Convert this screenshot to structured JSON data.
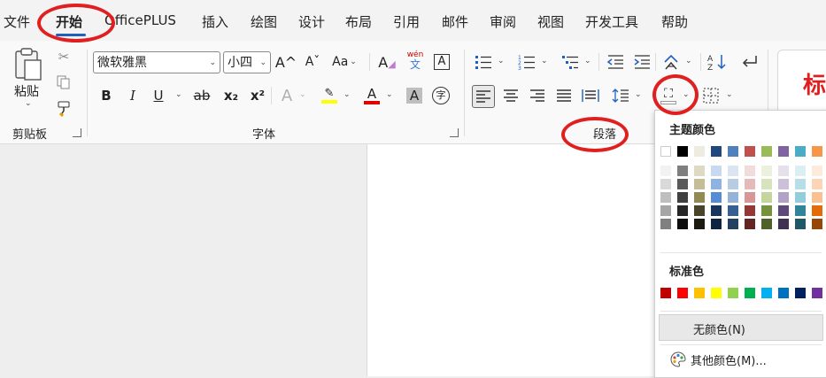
{
  "tabs": [
    "文件",
    "开始",
    "OfficePLUS",
    "插入",
    "绘图",
    "设计",
    "布局",
    "引用",
    "邮件",
    "审阅",
    "视图",
    "开发工具",
    "帮助"
  ],
  "clipboard": {
    "paste_label": "粘贴",
    "group_label": "剪贴板"
  },
  "font": {
    "name": "微软雅黑",
    "size": "小四",
    "group_label": "字体",
    "change_case_label": "Aa",
    "phonetic_top": "wén",
    "phonetic_bottom": "文",
    "char_shading": "A",
    "char_border": "A",
    "char_circle": "字",
    "bold": "B",
    "italic": "I",
    "underline": "U",
    "strike": "ab",
    "sub": "x₂",
    "sup": "x²",
    "grow": "A^",
    "shrink": "Aˇ"
  },
  "paragraph": {
    "group_label": "段落"
  },
  "styles": {
    "sample": "标"
  },
  "shading_menu": {
    "theme_label": "主题颜色",
    "standard_label": "标准色",
    "no_color": "无颜色(N)",
    "more_colors": "其他颜色(M)...",
    "theme_colors": [
      [
        "#ffffff",
        "#f2f2f2",
        "#d9d9d9",
        "#bfbfbf",
        "#a6a6a6",
        "#808080"
      ],
      [
        "#000000",
        "#7f7f7f",
        "#595959",
        "#404040",
        "#262626",
        "#0d0d0d"
      ],
      [
        "#eeece1",
        "#ddd9c3",
        "#c4bd97",
        "#938953",
        "#494429",
        "#1d1b10"
      ],
      [
        "#1f497d",
        "#c6d9f0",
        "#8db3e2",
        "#548dd4",
        "#17365d",
        "#0f243e"
      ],
      [
        "#4f81bd",
        "#dbe5f1",
        "#b8cce4",
        "#95b3d7",
        "#366092",
        "#244061"
      ],
      [
        "#c0504d",
        "#f2dcdb",
        "#e5b9b7",
        "#d99694",
        "#953734",
        "#632423"
      ],
      [
        "#9bbb59",
        "#ebf1dd",
        "#d7e3bc",
        "#c3d69b",
        "#76923c",
        "#4f6128"
      ],
      [
        "#8064a2",
        "#e5e0ec",
        "#ccc1d9",
        "#b2a2c7",
        "#5f497a",
        "#3f3151"
      ],
      [
        "#4bacc6",
        "#dbeef3",
        "#b7dde8",
        "#92cddc",
        "#31859b",
        "#205867"
      ],
      [
        "#f79646",
        "#fdeada",
        "#fbd5b5",
        "#fac08f",
        "#e36c09",
        "#974806"
      ]
    ],
    "standard_colors": [
      "#c00000",
      "#ff0000",
      "#ffc000",
      "#ffff00",
      "#92d050",
      "#00b050",
      "#00b0f0",
      "#0070c0",
      "#002060",
      "#7030a0"
    ]
  }
}
